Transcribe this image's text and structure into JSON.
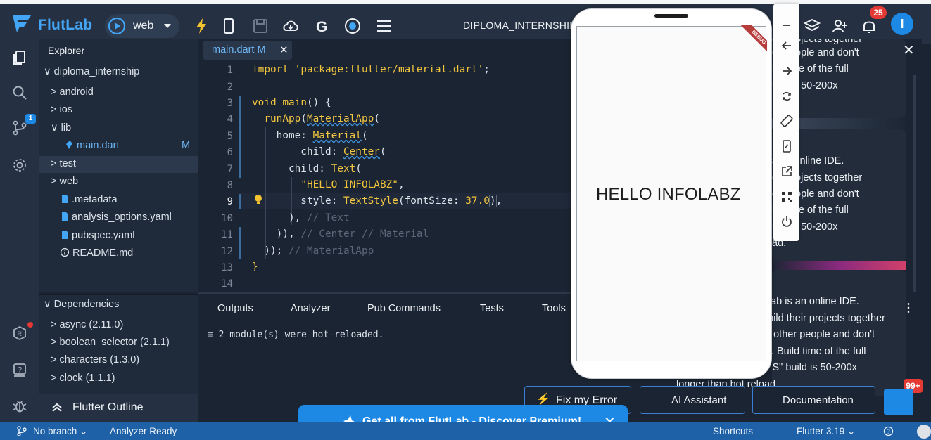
{
  "topbar": {
    "brand": "FlutLab",
    "target": "web",
    "project": "DIPLOMA_INTERNSHIP",
    "notif_count": "25",
    "avatar_letter": "I"
  },
  "activity": {
    "scm_badge": "1"
  },
  "explorer": {
    "title": "Explorer",
    "items": [
      {
        "label": "diploma_internship",
        "prefix": "∨"
      },
      {
        "label": "android",
        "prefix": ">"
      },
      {
        "label": "ios",
        "prefix": ">"
      },
      {
        "label": "lib",
        "prefix": "∨"
      },
      {
        "label": "main.dart",
        "status": "M"
      },
      {
        "label": "test",
        "prefix": ">"
      },
      {
        "label": "web",
        "prefix": ">"
      },
      {
        "label": ".metadata"
      },
      {
        "label": "analysis_options.yaml"
      },
      {
        "label": "pubspec.yaml"
      },
      {
        "label": "README.md"
      }
    ]
  },
  "dependencies": {
    "title": "Dependencies",
    "items": [
      "async (2.11.0)",
      "boolean_selector (2.1.1)",
      "characters (1.3.0)",
      "clock (1.1.1)"
    ]
  },
  "outline": {
    "title": "Flutter Outline"
  },
  "editor": {
    "tab_label": "main.dart M",
    "line_numbers": [
      "1",
      "2",
      "3",
      "4",
      "5",
      "6",
      "7",
      "8",
      "9",
      "10",
      "11",
      "12",
      "13",
      "14"
    ],
    "active_line": "9"
  },
  "panel": {
    "tabs": [
      "Outputs",
      "Analyzer",
      "Pub Commands",
      "Tests",
      "Tools"
    ],
    "output": "2 module(s) were hot-reloaded."
  },
  "preview": {
    "text": "HELLO INFOLABZ",
    "banner": "DEBUG"
  },
  "right_panel": {
    "card1": [
      "eir projects together",
      "er people and don't",
      "ild time of the full",
      "uild is 50-200x"
    ],
    "card2": [
      "s an online IDE.",
      "eir projects together",
      "er people and don't",
      "ild time of the full",
      "uild is 50-200x",
      "ad."
    ],
    "card3": [
      "tLab is an online IDE.",
      "build their projects together",
      "ut other people and don't",
      "rn. Build time of the full",
      "iOS\" build is 50-200x"
    ],
    "card3_last": "longer than hot reload.",
    "badge": "99+"
  },
  "actions": {
    "fix_label": "Fix my Error",
    "ai_label": "AI Assistant",
    "docs_label": "Documentation",
    "premium_label": "Get all from FlutLab - Discover Premium!"
  },
  "status": {
    "branch": "No branch",
    "analyzer": "Analyzer Ready",
    "shortcuts": "Shortcuts",
    "flutter": "Flutter 3.19"
  },
  "colors": {
    "accent": "#1e88e5",
    "brand": "#42a5f5",
    "keyword": "#f0c43d",
    "statusbar": "#1f61a6"
  }
}
